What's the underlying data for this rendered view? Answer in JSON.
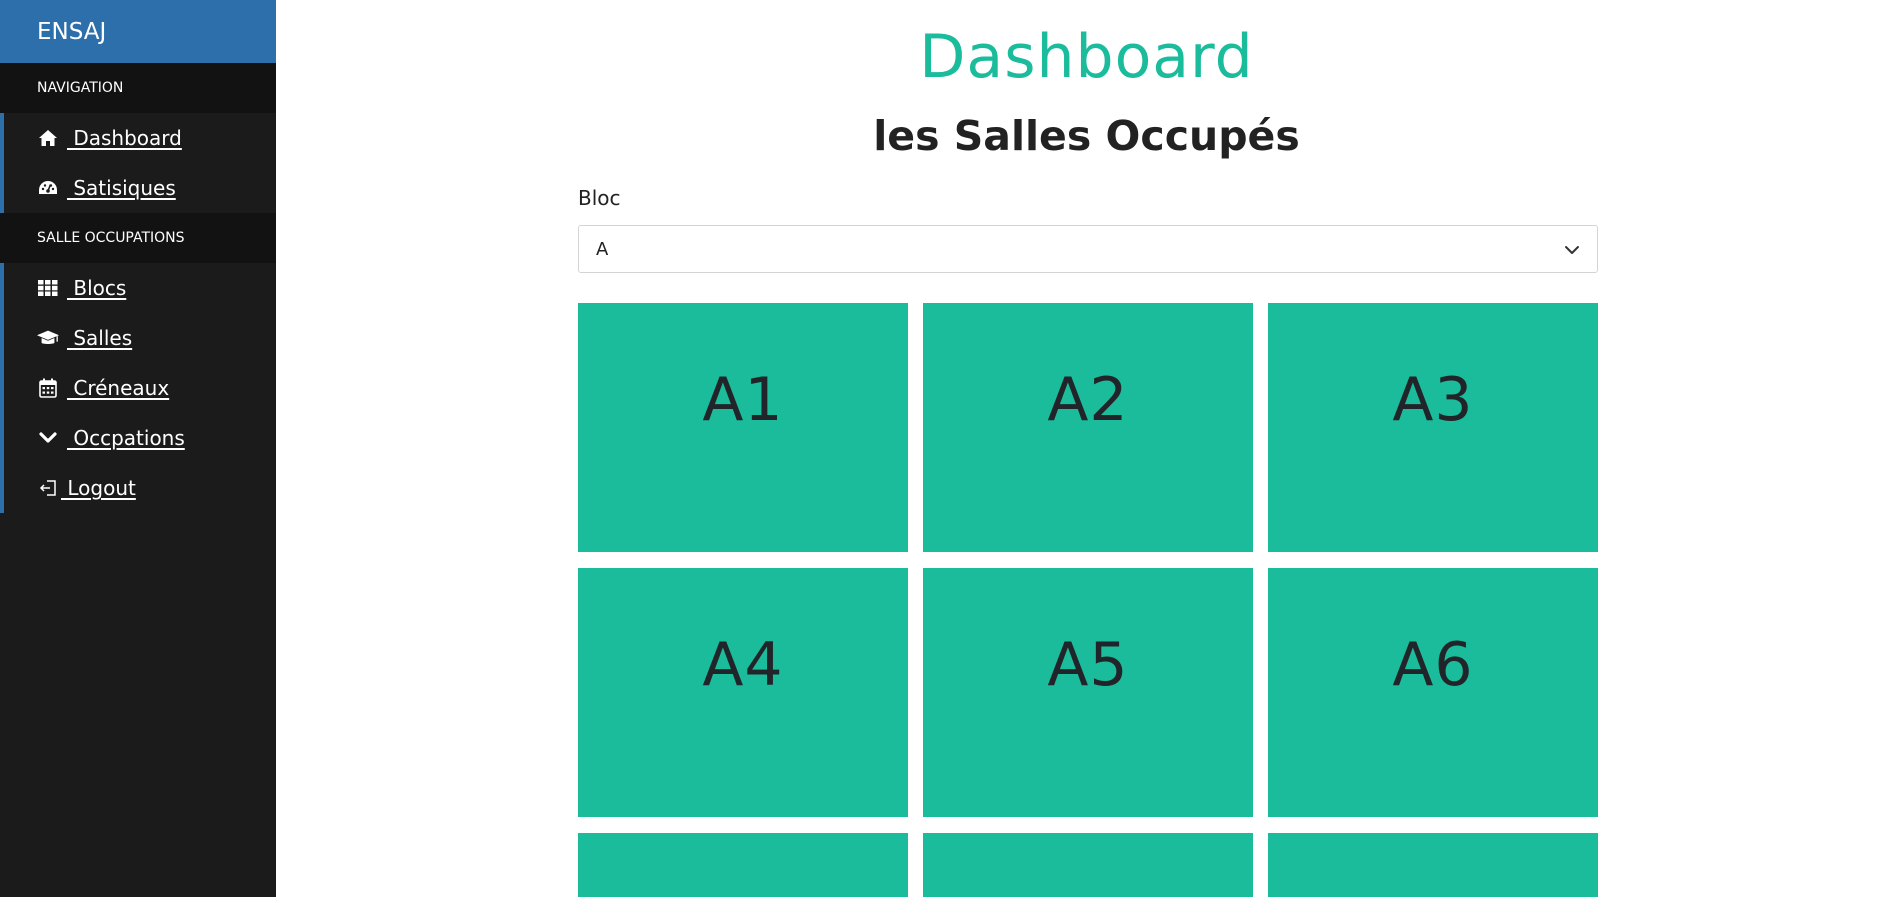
{
  "sidebar": {
    "brand": "ENSAJ",
    "sections": [
      {
        "header": "NAVIGATION",
        "items": [
          {
            "label": " Dashboard",
            "icon": "home-icon"
          },
          {
            "label": " Satisiques",
            "icon": "dashboard-gauge-icon"
          }
        ]
      },
      {
        "header": "SALLE OCCUPATIONS",
        "items": [
          {
            "label": " Blocs",
            "icon": "grid-icon"
          },
          {
            "label": " Salles",
            "icon": "graduation-cap-icon"
          },
          {
            "label": " Créneaux",
            "icon": "calendar-icon"
          },
          {
            "label": " Occpations",
            "icon": "chevron-down-icon"
          },
          {
            "label": " Logout",
            "icon": "logout-icon"
          }
        ]
      }
    ],
    "accent_color": "#2c6faa",
    "background_color": "#1b1b1b"
  },
  "main": {
    "title": "Dashboard",
    "subtitle": "les Salles Occupés",
    "bloc_filter": {
      "label": "Bloc",
      "selected": "A"
    },
    "tiles": [
      "A1",
      "A2",
      "A3",
      "A4",
      "A5",
      "A6",
      "",
      "",
      ""
    ],
    "tile_color": "#1abc9c",
    "title_color": "#1abc9c"
  }
}
